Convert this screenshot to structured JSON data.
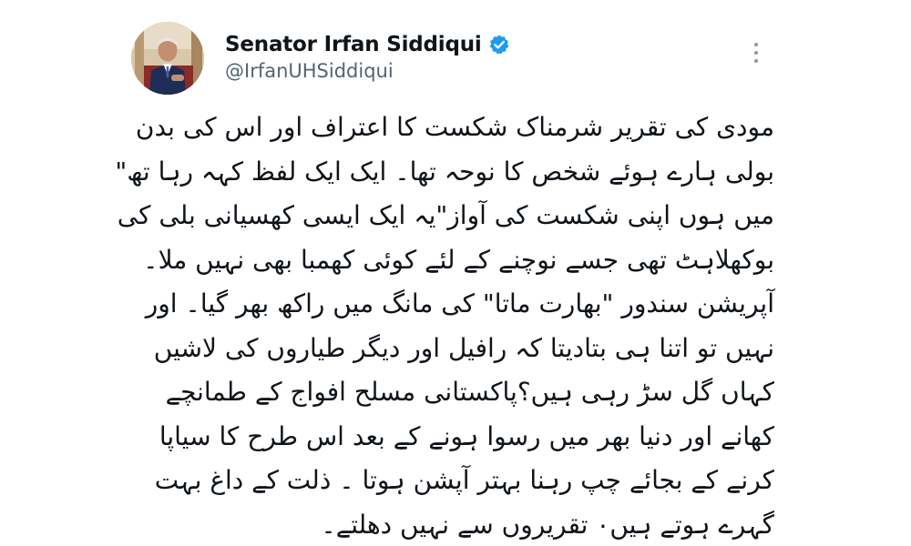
{
  "author": {
    "display_name": "Senator Irfan Siddiqui",
    "handle": "@IrfanUHSiddiqui",
    "verified": true,
    "verified_color": "#1d9bf0"
  },
  "tweet": {
    "lines": [
      "مودی کی تقریر شرمناک شکست کا اعتراف اور اس کی بدن",
      "بولی ہارے ہوئے شخص کا نوحہ تھا۔ ایک ایک لفظ کہہ رہا تھ\"",
      "میں ہوں اپنی شکست کی آواز\"یہ ایک ایسی کھسیانی بلی کی",
      "بوکھلاہٹ تھی جسے نوچنے کے لئے کوئی کھمبا بھی نہیں ملا۔",
      "آپریشن سندور \"بھارت ماتا\" کی مانگ میں راکھ بھر گیا۔ اور",
      "نہیں تو اتنا ہی بتادیتا کہ رافیل اور دیگر طیاروں کی لاشیں",
      "کہاں گل سڑ رہی ہیں؟پاکستانی مسلح افواج کے طمانچے",
      "کھانے اور دنیا بھر میں رسوا ہونے کے بعد اس طرح کا سیاپا",
      "کرنے کے بجائے چپ رہنا بہتر آپشن ہوتا ۔ ذلت کے داغ بہت",
      "گہرے ہوتے ہیں۰ تقریروں سے نہیں دھلتے۔"
    ]
  },
  "icons": {
    "avatar": "profile-photo",
    "verified": "verified-badge-icon",
    "more": "more-options-icon"
  }
}
